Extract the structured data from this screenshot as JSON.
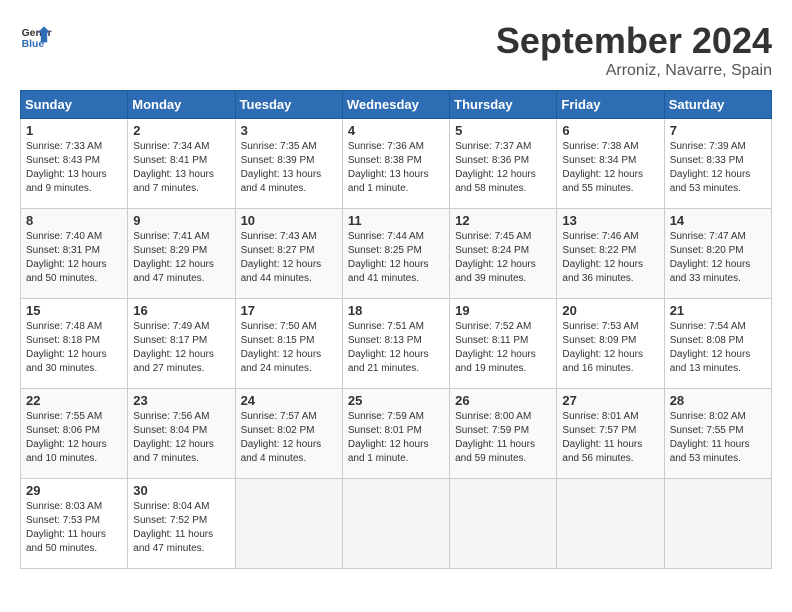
{
  "header": {
    "logo_line1": "General",
    "logo_line2": "Blue",
    "month_title": "September 2024",
    "location": "Arroniz, Navarre, Spain"
  },
  "weekdays": [
    "Sunday",
    "Monday",
    "Tuesday",
    "Wednesday",
    "Thursday",
    "Friday",
    "Saturday"
  ],
  "weeks": [
    [
      {
        "day": "1",
        "info": "Sunrise: 7:33 AM\nSunset: 8:43 PM\nDaylight: 13 hours\nand 9 minutes."
      },
      {
        "day": "2",
        "info": "Sunrise: 7:34 AM\nSunset: 8:41 PM\nDaylight: 13 hours\nand 7 minutes."
      },
      {
        "day": "3",
        "info": "Sunrise: 7:35 AM\nSunset: 8:39 PM\nDaylight: 13 hours\nand 4 minutes."
      },
      {
        "day": "4",
        "info": "Sunrise: 7:36 AM\nSunset: 8:38 PM\nDaylight: 13 hours\nand 1 minute."
      },
      {
        "day": "5",
        "info": "Sunrise: 7:37 AM\nSunset: 8:36 PM\nDaylight: 12 hours\nand 58 minutes."
      },
      {
        "day": "6",
        "info": "Sunrise: 7:38 AM\nSunset: 8:34 PM\nDaylight: 12 hours\nand 55 minutes."
      },
      {
        "day": "7",
        "info": "Sunrise: 7:39 AM\nSunset: 8:33 PM\nDaylight: 12 hours\nand 53 minutes."
      }
    ],
    [
      {
        "day": "8",
        "info": "Sunrise: 7:40 AM\nSunset: 8:31 PM\nDaylight: 12 hours\nand 50 minutes."
      },
      {
        "day": "9",
        "info": "Sunrise: 7:41 AM\nSunset: 8:29 PM\nDaylight: 12 hours\nand 47 minutes."
      },
      {
        "day": "10",
        "info": "Sunrise: 7:43 AM\nSunset: 8:27 PM\nDaylight: 12 hours\nand 44 minutes."
      },
      {
        "day": "11",
        "info": "Sunrise: 7:44 AM\nSunset: 8:25 PM\nDaylight: 12 hours\nand 41 minutes."
      },
      {
        "day": "12",
        "info": "Sunrise: 7:45 AM\nSunset: 8:24 PM\nDaylight: 12 hours\nand 39 minutes."
      },
      {
        "day": "13",
        "info": "Sunrise: 7:46 AM\nSunset: 8:22 PM\nDaylight: 12 hours\nand 36 minutes."
      },
      {
        "day": "14",
        "info": "Sunrise: 7:47 AM\nSunset: 8:20 PM\nDaylight: 12 hours\nand 33 minutes."
      }
    ],
    [
      {
        "day": "15",
        "info": "Sunrise: 7:48 AM\nSunset: 8:18 PM\nDaylight: 12 hours\nand 30 minutes."
      },
      {
        "day": "16",
        "info": "Sunrise: 7:49 AM\nSunset: 8:17 PM\nDaylight: 12 hours\nand 27 minutes."
      },
      {
        "day": "17",
        "info": "Sunrise: 7:50 AM\nSunset: 8:15 PM\nDaylight: 12 hours\nand 24 minutes."
      },
      {
        "day": "18",
        "info": "Sunrise: 7:51 AM\nSunset: 8:13 PM\nDaylight: 12 hours\nand 21 minutes."
      },
      {
        "day": "19",
        "info": "Sunrise: 7:52 AM\nSunset: 8:11 PM\nDaylight: 12 hours\nand 19 minutes."
      },
      {
        "day": "20",
        "info": "Sunrise: 7:53 AM\nSunset: 8:09 PM\nDaylight: 12 hours\nand 16 minutes."
      },
      {
        "day": "21",
        "info": "Sunrise: 7:54 AM\nSunset: 8:08 PM\nDaylight: 12 hours\nand 13 minutes."
      }
    ],
    [
      {
        "day": "22",
        "info": "Sunrise: 7:55 AM\nSunset: 8:06 PM\nDaylight: 12 hours\nand 10 minutes."
      },
      {
        "day": "23",
        "info": "Sunrise: 7:56 AM\nSunset: 8:04 PM\nDaylight: 12 hours\nand 7 minutes."
      },
      {
        "day": "24",
        "info": "Sunrise: 7:57 AM\nSunset: 8:02 PM\nDaylight: 12 hours\nand 4 minutes."
      },
      {
        "day": "25",
        "info": "Sunrise: 7:59 AM\nSunset: 8:01 PM\nDaylight: 12 hours\nand 1 minute."
      },
      {
        "day": "26",
        "info": "Sunrise: 8:00 AM\nSunset: 7:59 PM\nDaylight: 11 hours\nand 59 minutes."
      },
      {
        "day": "27",
        "info": "Sunrise: 8:01 AM\nSunset: 7:57 PM\nDaylight: 11 hours\nand 56 minutes."
      },
      {
        "day": "28",
        "info": "Sunrise: 8:02 AM\nSunset: 7:55 PM\nDaylight: 11 hours\nand 53 minutes."
      }
    ],
    [
      {
        "day": "29",
        "info": "Sunrise: 8:03 AM\nSunset: 7:53 PM\nDaylight: 11 hours\nand 50 minutes."
      },
      {
        "day": "30",
        "info": "Sunrise: 8:04 AM\nSunset: 7:52 PM\nDaylight: 11 hours\nand 47 minutes."
      },
      null,
      null,
      null,
      null,
      null
    ]
  ]
}
